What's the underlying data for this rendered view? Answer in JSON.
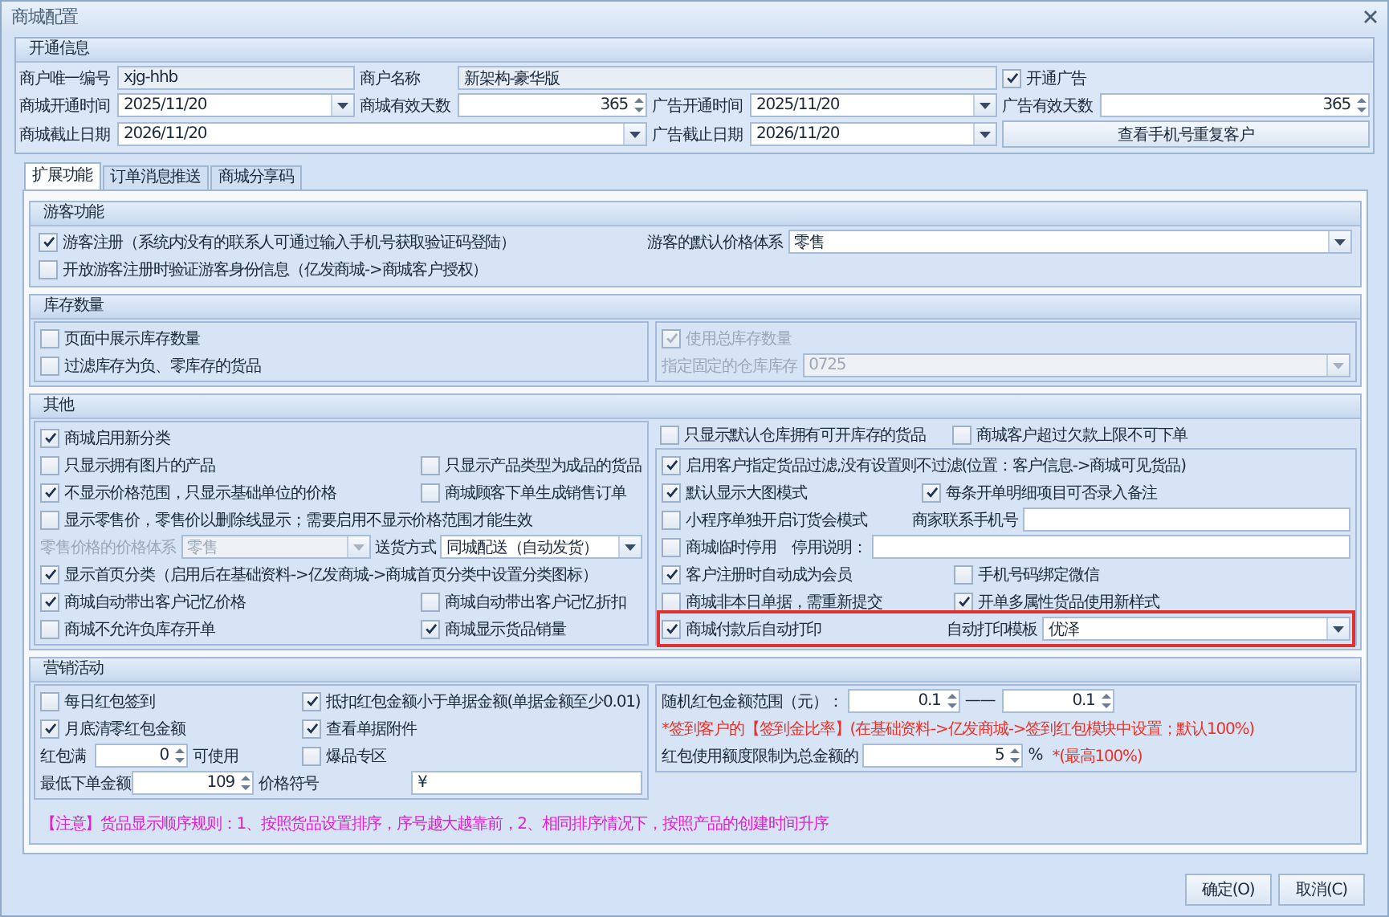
{
  "window": {
    "title": "商城配置"
  },
  "info": {
    "title": "开通信息",
    "rows": [
      {
        "items": [
          {
            "kind": "label",
            "text": "商户唯一编号"
          },
          {
            "kind": "field",
            "value": "xjg-hhb"
          },
          {
            "kind": "label",
            "text": "商户名称"
          },
          {
            "kind": "field",
            "value": "新架构-豪华版"
          },
          {
            "kind": "check",
            "text": "开通广告",
            "checked": true,
            "disabled": false
          }
        ]
      },
      {
        "items": [
          {
            "kind": "label",
            "text": "商城开通时间"
          },
          {
            "kind": "combo",
            "value": "2025/11/20",
            "disabled": false
          },
          {
            "kind": "label",
            "text": "商城有效天数"
          },
          {
            "kind": "spin",
            "value": "365"
          },
          {
            "kind": "label",
            "text": "广告开通时间"
          },
          {
            "kind": "combo",
            "value": "2025/11/20",
            "disabled": false
          },
          {
            "kind": "label",
            "text": "广告有效天数"
          },
          {
            "kind": "spin",
            "value": "365"
          }
        ]
      },
      {
        "items": [
          {
            "kind": "label",
            "text": "商城截止日期"
          },
          {
            "kind": "combo",
            "value": "2026/11/20",
            "disabled": false
          },
          {
            "kind": "label",
            "text": "广告截止日期"
          },
          {
            "kind": "combo",
            "value": "2026/11/20",
            "disabled": false
          },
          {
            "kind": "button",
            "text": "查看手机号重复客户"
          }
        ]
      }
    ]
  },
  "tabs": [
    {
      "label": "扩展功能",
      "selected": true
    },
    {
      "label": "订单消息推送",
      "selected": false
    },
    {
      "label": "商城分享码",
      "selected": false
    }
  ],
  "sections": [
    {
      "title": "游客功能",
      "columns": [
        {
          "rows": [
            {
              "items": [
                {
                  "kind": "check",
                  "text": "游客注册（系统内没有的联系人可通过输入手机号获取验证码登陆）",
                  "checked": true,
                  "disabled": false
                },
                {
                  "kind": "label",
                  "text": "游客的默认价格体系"
                },
                {
                  "kind": "combo",
                  "value": "零售",
                  "disabled": false
                }
              ]
            },
            {
              "items": [
                {
                  "kind": "check",
                  "text": "开放游客注册时验证游客身份信息（亿发商城->商城客户授权）",
                  "checked": false,
                  "disabled": false
                }
              ]
            }
          ]
        }
      ]
    },
    {
      "title": "库存数量",
      "columns": [
        {
          "rows": [
            {
              "items": [
                {
                  "kind": "check",
                  "text": "页面中展示库存数量",
                  "checked": false,
                  "disabled": false
                }
              ]
            },
            {
              "items": [
                {
                  "kind": "check",
                  "text": "过滤库存为负、零库存的货品",
                  "checked": false,
                  "disabled": false
                }
              ]
            }
          ]
        },
        {
          "rows": [
            {
              "items": [
                {
                  "kind": "check",
                  "text": "使用总库存数量",
                  "checked": true,
                  "disabled": true
                }
              ]
            },
            {
              "items": [
                {
                  "kind": "label",
                  "text": "指定固定的仓库库存",
                  "disabled": true
                },
                {
                  "kind": "combo",
                  "value": "0725",
                  "disabled": true
                }
              ]
            }
          ]
        }
      ]
    },
    {
      "title": "其他",
      "columns": [
        {
          "rows": [
            {
              "items": [
                {
                  "kind": "check",
                  "text": "商城启用新分类",
                  "checked": true,
                  "disabled": false
                }
              ]
            },
            {
              "items": [
                {
                  "kind": "check",
                  "text": "只显示拥有图片的产品",
                  "checked": false,
                  "disabled": false
                },
                {
                  "kind": "check",
                  "text": "只显示产品类型为成品的货品",
                  "checked": false,
                  "disabled": false
                }
              ]
            },
            {
              "items": [
                {
                  "kind": "check",
                  "text": "不显示价格范围，只显示基础单位的价格",
                  "checked": true,
                  "disabled": false
                },
                {
                  "kind": "check",
                  "text": "商城顾客下单生成销售订单",
                  "checked": false,
                  "disabled": false
                }
              ]
            },
            {
              "items": [
                {
                  "kind": "check",
                  "text": "显示零售价，零售价以删除线显示；需要启用不显示价格范围才能生效",
                  "checked": false,
                  "disabled": false
                }
              ]
            },
            {
              "items": [
                {
                  "kind": "label",
                  "text": "零售价格的价格体系",
                  "disabled": true
                },
                {
                  "kind": "combo",
                  "value": "零售",
                  "disabled": true
                },
                {
                  "kind": "label",
                  "text": "送货方式"
                },
                {
                  "kind": "combo",
                  "value": "同城配送（自动发货）",
                  "disabled": false
                }
              ]
            },
            {
              "items": [
                {
                  "kind": "check",
                  "text": "显示首页分类（启用后在基础资料->亿发商城->商城首页分类中设置分类图标）",
                  "checked": true,
                  "disabled": false
                }
              ]
            },
            {
              "items": [
                {
                  "kind": "check",
                  "text": "商城自动带出客户记忆价格",
                  "checked": true,
                  "disabled": false
                },
                {
                  "kind": "check",
                  "text": "商城自动带出客户记忆折扣",
                  "checked": false,
                  "disabled": false
                }
              ]
            },
            {
              "items": [
                {
                  "kind": "check",
                  "text": "商城不允许负库存开单",
                  "checked": false,
                  "disabled": false
                },
                {
                  "kind": "check",
                  "text": "商城显示货品销量",
                  "checked": true,
                  "disabled": false
                }
              ]
            }
          ]
        },
        {
          "top": {
            "items": [
              {
                "kind": "check",
                "text": "只显示默认仓库拥有可开库存的货品",
                "checked": false,
                "disabled": false
              },
              {
                "kind": "check",
                "text": "商城客户超过欠款上限不可下单",
                "checked": false,
                "disabled": false
              }
            ]
          },
          "rows": [
            {
              "highlighted": false,
              "items": [
                {
                  "kind": "check",
                  "text": "启用客户指定货品过滤,没有设置则不过滤(位置：客户信息->商城可见货品)",
                  "checked": true,
                  "disabled": false
                }
              ]
            },
            {
              "highlighted": false,
              "items": [
                {
                  "kind": "check",
                  "text": "默认显示大图模式",
                  "checked": true,
                  "disabled": false
                },
                {
                  "kind": "check",
                  "text": "每条开单明细项目可否录入备注",
                  "checked": true,
                  "disabled": false
                }
              ]
            },
            {
              "highlighted": false,
              "items": [
                {
                  "kind": "check",
                  "text": "小程序单独开启订货会模式",
                  "checked": false,
                  "disabled": false
                },
                {
                  "kind": "label",
                  "text": "商家联系手机号"
                },
                {
                  "kind": "field"
                }
              ]
            },
            {
              "highlighted": false,
              "items": [
                {
                  "kind": "check",
                  "text": "商城临时停用",
                  "checked": false,
                  "disabled": false
                },
                {
                  "kind": "label",
                  "text": "停用说明："
                },
                {
                  "kind": "field"
                }
              ]
            },
            {
              "highlighted": false,
              "items": [
                {
                  "kind": "check",
                  "text": "客户注册时自动成为会员",
                  "checked": true,
                  "disabled": false
                },
                {
                  "kind": "check",
                  "text": "手机号码绑定微信",
                  "checked": false,
                  "disabled": false
                }
              ]
            },
            {
              "highlighted": false,
              "items": [
                {
                  "kind": "check",
                  "text": "商城非本日单据，需重新提交",
                  "checked": false,
                  "disabled": false
                },
                {
                  "kind": "check",
                  "text": "开单多属性货品使用新样式",
                  "checked": true,
                  "disabled": false
                }
              ]
            },
            {
              "highlighted": true,
              "items": [
                {
                  "kind": "check",
                  "text": "商城付款后自动打印",
                  "checked": true,
                  "disabled": false
                },
                {
                  "kind": "label",
                  "text": "自动打印模板"
                },
                {
                  "kind": "combo",
                  "value": "优泽",
                  "disabled": false
                }
              ]
            }
          ]
        }
      ]
    },
    {
      "title": "营销活动",
      "columns": [
        {
          "rows": [
            {
              "items": [
                {
                  "kind": "check",
                  "text": "每日红包签到",
                  "checked": false,
                  "disabled": false
                },
                {
                  "kind": "check",
                  "text": "抵扣红包金额小于单据金额(单据金额至少0.01)",
                  "checked": true,
                  "disabled": false
                }
              ]
            },
            {
              "items": [
                {
                  "kind": "check",
                  "text": "月底清零红包金额",
                  "checked": true,
                  "disabled": false
                },
                {
                  "kind": "check",
                  "text": "查看单据附件",
                  "checked": true,
                  "disabled": false
                }
              ]
            },
            {
              "items": [
                {
                  "kind": "label",
                  "text": "红包满"
                },
                {
                  "kind": "spin",
                  "value": "0"
                },
                {
                  "kind": "label",
                  "text": "可使用"
                },
                {
                  "kind": "check",
                  "text": "爆品专区",
                  "checked": false,
                  "disabled": false
                }
              ]
            },
            {
              "items": [
                {
                  "kind": "label",
                  "text": "最低下单金额"
                },
                {
                  "kind": "spin",
                  "value": "109"
                },
                {
                  "kind": "label",
                  "text": "价格符号"
                },
                {
                  "kind": "field",
                  "value": "¥"
                }
              ]
            }
          ]
        },
        {
          "rows": [
            {
              "items": [
                {
                  "kind": "label",
                  "text": "随机红包金额范围（元）："
                },
                {
                  "kind": "spin",
                  "value": "0.1"
                },
                {
                  "kind": "label",
                  "text": "——"
                },
                {
                  "kind": "spin",
                  "value": "0.1"
                }
              ]
            },
            {
              "items": [
                {
                  "kind": "note",
                  "text": "*签到客户的【签到金比率】(在基础资料->亿发商城->签到红包模块中设置；默认100%)",
                  "color": "#e8322a"
                }
              ]
            },
            {
              "items": [
                {
                  "kind": "label",
                  "text": "红包使用额度限制为总金额的"
                },
                {
                  "kind": "spin",
                  "value": "5"
                },
                {
                  "kind": "label",
                  "text": "%"
                },
                {
                  "kind": "note",
                  "text": "*(最高100%)",
                  "color": "#e8322a"
                }
              ]
            }
          ]
        }
      ],
      "footer_note": {
        "text": "【注意】货品显示顺序规则：1、按照货品设置排序，序号越大越靠前，2、相同排序情况下，按照产品的创建时间升序",
        "color": "#e020d0"
      }
    }
  ],
  "buttons": [
    "确定(O)",
    "取消(C)"
  ]
}
